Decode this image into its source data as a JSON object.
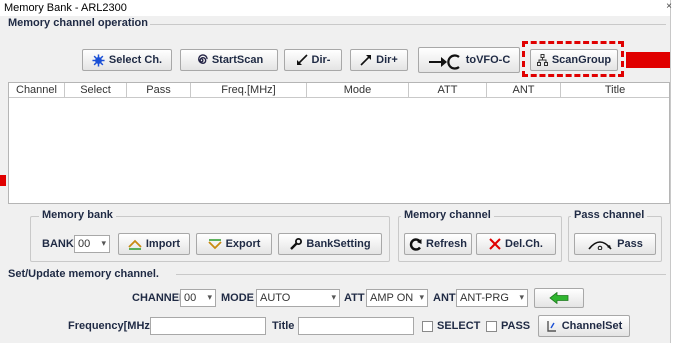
{
  "window": {
    "title": "Memory Bank - ARL2300",
    "close_glyph": "×"
  },
  "operation": {
    "section_label": "Memory channel operation",
    "buttons": [
      {
        "label": "Select Ch.",
        "icon": "sun-icon"
      },
      {
        "label": "StartScan",
        "icon": "spiral-icon"
      },
      {
        "label": "Dir-",
        "icon": "arrow-down-left-icon"
      },
      {
        "label": "Dir+",
        "icon": "arrow-up-right-icon"
      },
      {
        "label": "toVFO-C",
        "icon": "vfo-arrow-icon"
      },
      {
        "label": "ScanGroup",
        "icon": "tree-icon"
      }
    ]
  },
  "table": {
    "columns": [
      "Channel",
      "Select",
      "Pass",
      "Freq.[MHz]",
      "Mode",
      "ATT",
      "ANT",
      "Title"
    ],
    "rows": []
  },
  "memory_bank": {
    "title": "Memory bank",
    "bank_label": "BANK",
    "bank_value": "00",
    "import_label": "Import",
    "export_label": "Export",
    "bank_setting_label": "BankSetting"
  },
  "memory_channel": {
    "title": "Memory channel",
    "refresh_label": "Refresh",
    "del_label": "Del.Ch."
  },
  "pass_channel": {
    "title": "Pass channel",
    "pass_label": "Pass"
  },
  "set_update": {
    "section_label": "Set/Update memory channel.",
    "channel_label": "CHANNEL",
    "channel_value": "00",
    "mode_label": "MODE",
    "mode_value": "AUTO",
    "att_label": "ATT",
    "att_value": "AMP ON",
    "ant_label": "ANT",
    "ant_value": "ANT-PRG",
    "freq_label": "Frequency[MHz]",
    "freq_value": "",
    "title_label": "Title",
    "title_value": "",
    "select_label": "SELECT",
    "pass_check_label": "PASS",
    "channelset_label": "ChannelSet"
  },
  "colors": {
    "highlight": "#e00000",
    "accent_green": "#2fb52f",
    "section_text": "#1f2a44"
  }
}
